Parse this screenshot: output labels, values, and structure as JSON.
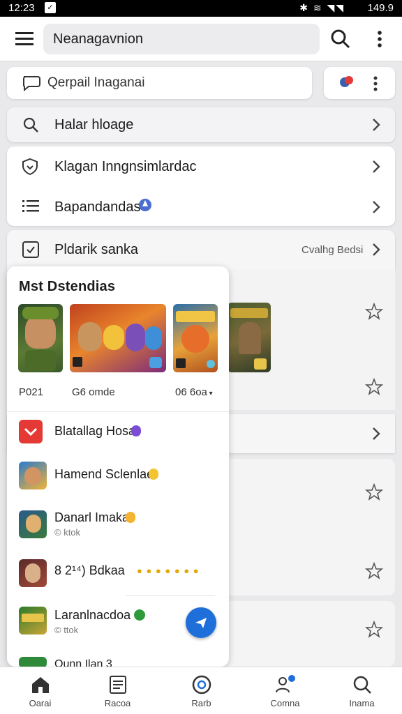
{
  "status_bar": {
    "time": "12:23",
    "battery": "149.9"
  },
  "app_bar": {
    "search_text": "Neanagavnion"
  },
  "chip": {
    "label": "Qerpail Inaganai"
  },
  "row_search": {
    "label": "Halar hloage"
  },
  "group": [
    {
      "label": "Klagan Inngnsimlardac"
    },
    {
      "label": "Bapandandas"
    }
  ],
  "row_checklist": {
    "label": "Pldarik sanka",
    "trailing": "Cvalhg Bedsi"
  },
  "popup": {
    "title": "Mst  Dstendias",
    "meta_left": "P021",
    "meta_mid": "G6 omde",
    "meta_right": "06 6oa",
    "items": [
      {
        "title": "Blatallag Hosa",
        "sub": ""
      },
      {
        "title": "Hamend Sclenlae",
        "sub": ""
      },
      {
        "title": "Danarl Imaka",
        "sub": "© ktok"
      },
      {
        "title": "8 2¹⁴)  Bdkaa",
        "sub": ""
      },
      {
        "title": "Laranlnacdoa",
        "sub": "© ttok"
      },
      {
        "title": "Ounn Ilan 3",
        "sub": ""
      }
    ]
  },
  "bottom_nav": [
    {
      "label": "Oarai"
    },
    {
      "label": "Racoa"
    },
    {
      "label": "Rarb"
    },
    {
      "label": "Comna"
    },
    {
      "label": "Inama"
    }
  ],
  "colors": {
    "accent": "#1e6fd9",
    "background": "#e9e9eb",
    "red_icon": "#e53935"
  }
}
